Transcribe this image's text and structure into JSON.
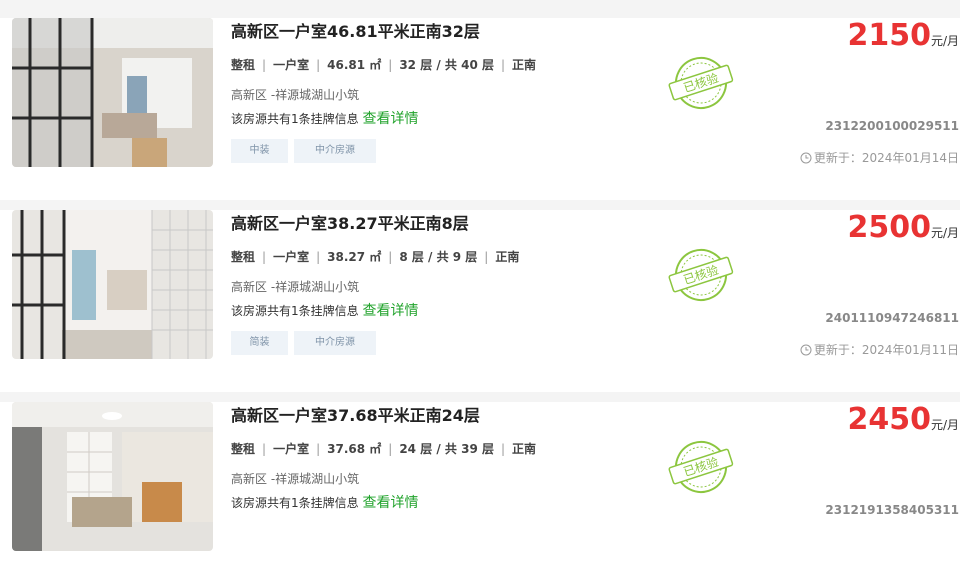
{
  "listings": [
    {
      "title": "高新区一户室46.81平米正南32层",
      "rent_type": "整租",
      "room": "一户室",
      "area": "46.81 ㎡",
      "floor": "32 层 / 共 40 层",
      "orientation": "正南",
      "address": "高新区 -祥源城湖山小筑",
      "info_text": "该房源共有1条挂牌信息",
      "detail_link": "查看详情",
      "tags": [
        "中装",
        "中介房源"
      ],
      "verified": "已核验",
      "price": "2150",
      "unit": "元/月",
      "id": "2312200100029511",
      "updated": "更新于：2024年01月14日"
    },
    {
      "title": "高新区一户室38.27平米正南8层",
      "rent_type": "整租",
      "room": "一户室",
      "area": "38.27 ㎡",
      "floor": "8 层 / 共 9 层",
      "orientation": "正南",
      "address": "高新区 -祥源城湖山小筑",
      "info_text": "该房源共有1条挂牌信息",
      "detail_link": "查看详情",
      "tags": [
        "简装",
        "中介房源"
      ],
      "verified": "已核验",
      "price": "2500",
      "unit": "元/月",
      "id": "2401110947246811",
      "updated": "更新于：2024年01月11日"
    },
    {
      "title": "高新区一户室37.68平米正南24层",
      "rent_type": "整租",
      "room": "一户室",
      "area": "37.68 ㎡",
      "floor": "24 层 / 共 39 层",
      "orientation": "正南",
      "address": "高新区 -祥源城湖山小筑",
      "info_text": "该房源共有1条挂牌信息",
      "detail_link": "查看详情",
      "tags": [],
      "verified": "已核验",
      "price": "2450",
      "unit": "元/月",
      "id": "2312191358405311",
      "updated": ""
    }
  ],
  "colors": {
    "price": "#e83333",
    "link": "#22a32c",
    "badge": "#8cc63f",
    "tag_bg": "#eef3f8"
  }
}
